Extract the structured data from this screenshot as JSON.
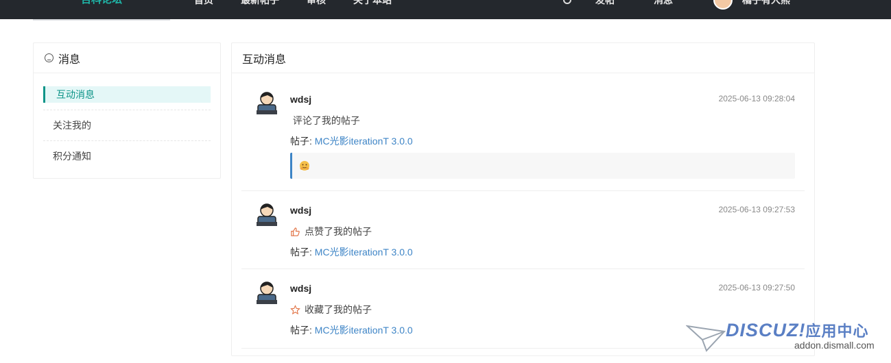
{
  "topbar": {
    "logo": "百科论坛",
    "nav": [
      "首页",
      "最新帖子",
      "审核",
      "关于本站"
    ],
    "post": "发帖",
    "messages": "消息",
    "user": "橘子有人熊"
  },
  "sidebar": {
    "title": "消息",
    "items": [
      "互动消息",
      "关注我的",
      "积分通知"
    ]
  },
  "panel": {
    "title": "互动消息",
    "messages": [
      {
        "user": "wdsj",
        "time": "2025-06-13 09:28:04",
        "action": " 评论了我的帖子",
        "post_prefix": "帖子: ",
        "post_title": "MC光影iterationT 3.0.0"
      },
      {
        "user": "wdsj",
        "time": "2025-06-13 09:27:53",
        "action": "点赞了我的帖子",
        "action_icon": "thumbs-up-icon",
        "post_prefix": "帖子: ",
        "post_title": "MC光影iterationT 3.0.0"
      },
      {
        "user": "wdsj",
        "time": "2025-06-13 09:27:50",
        "action": "收藏了我的帖子",
        "action_icon": "star-icon",
        "post_prefix": "帖子: ",
        "post_title": "MC光影iterationT 3.0.0"
      }
    ]
  },
  "watermark": {
    "brand": "DISCUZ!",
    "brand_cn": "应用中心",
    "site": "addon.dismall.com"
  },
  "colors": {
    "accent": "#0d9488",
    "link": "#3d84c6",
    "topbar": "#24282d",
    "icon_orange": "#e06c3c"
  }
}
